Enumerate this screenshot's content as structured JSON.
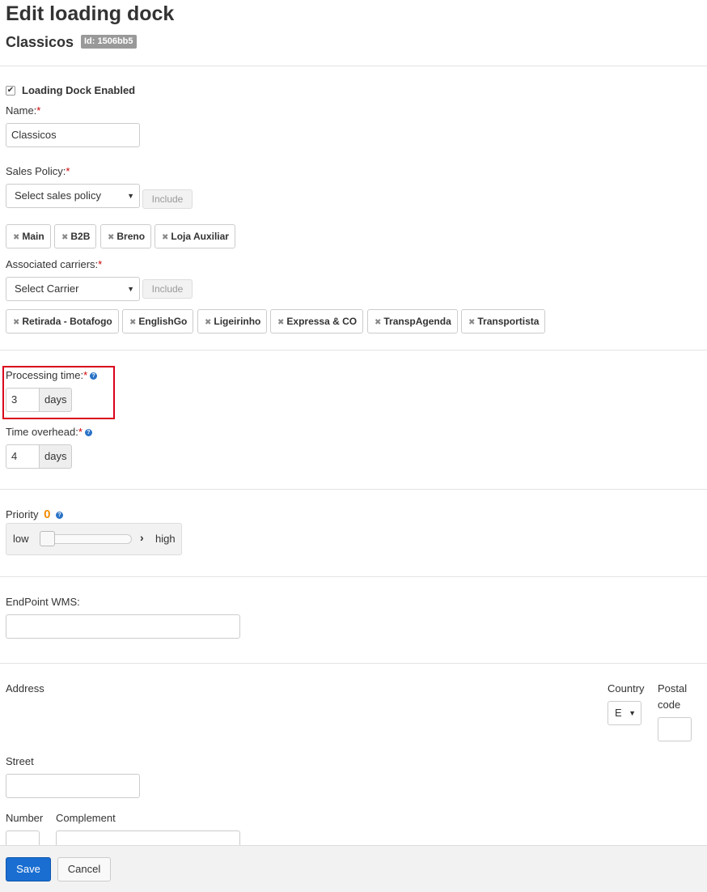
{
  "page": {
    "title": "Edit loading dock",
    "subtitle": "Classicos",
    "id_badge": "Id: 1506bb5"
  },
  "enabled": {
    "label": "Loading Dock Enabled",
    "checked": true
  },
  "name": {
    "label": "Name:",
    "required": "*",
    "value": "Classicos"
  },
  "sales_policy": {
    "label": "Sales Policy:",
    "required": "*",
    "select_text": "Select sales policy",
    "include_label": "Include",
    "tags": [
      "Main",
      "B2B",
      "Breno",
      "Loja Auxiliar"
    ]
  },
  "carriers": {
    "label": "Associated carriers:",
    "required": "*",
    "select_text": "Select Carrier",
    "include_label": "Include",
    "tags": [
      "Retirada - Botafogo",
      "EnglishGo",
      "Ligeirinho",
      "Expressa & CO",
      "TranspAgenda",
      "Transportista"
    ]
  },
  "processing_time": {
    "label": "Processing time:",
    "required": "*",
    "value": "3",
    "unit": "days"
  },
  "time_overhead": {
    "label": "Time overhead:",
    "required": "*",
    "value": "4",
    "unit": "days"
  },
  "priority": {
    "label": "Priority",
    "value": "0",
    "low": "low",
    "high": "high",
    "level": 0
  },
  "endpoint": {
    "label": "EndPoint WMS:",
    "value": ""
  },
  "address": {
    "label": "Address",
    "country_label": "Country",
    "country_value": "E",
    "postal_label": "Postal code",
    "street_label": "Street",
    "number_label": "Number",
    "complement_label": "Complement"
  },
  "footer": {
    "save_label": "Save",
    "cancel_label": "Cancel"
  },
  "colors": {
    "required": "#cc0000",
    "primary": "#1a6ed1",
    "highlight": "#d9001b",
    "priority": "#f28c00",
    "help": "#2a73c7"
  },
  "icons": {
    "help": "help-icon",
    "remove": "remove-x-icon",
    "dropdown": "caret-down-icon",
    "check": "check-icon",
    "slider_arrow": "chevron-right-icon"
  }
}
